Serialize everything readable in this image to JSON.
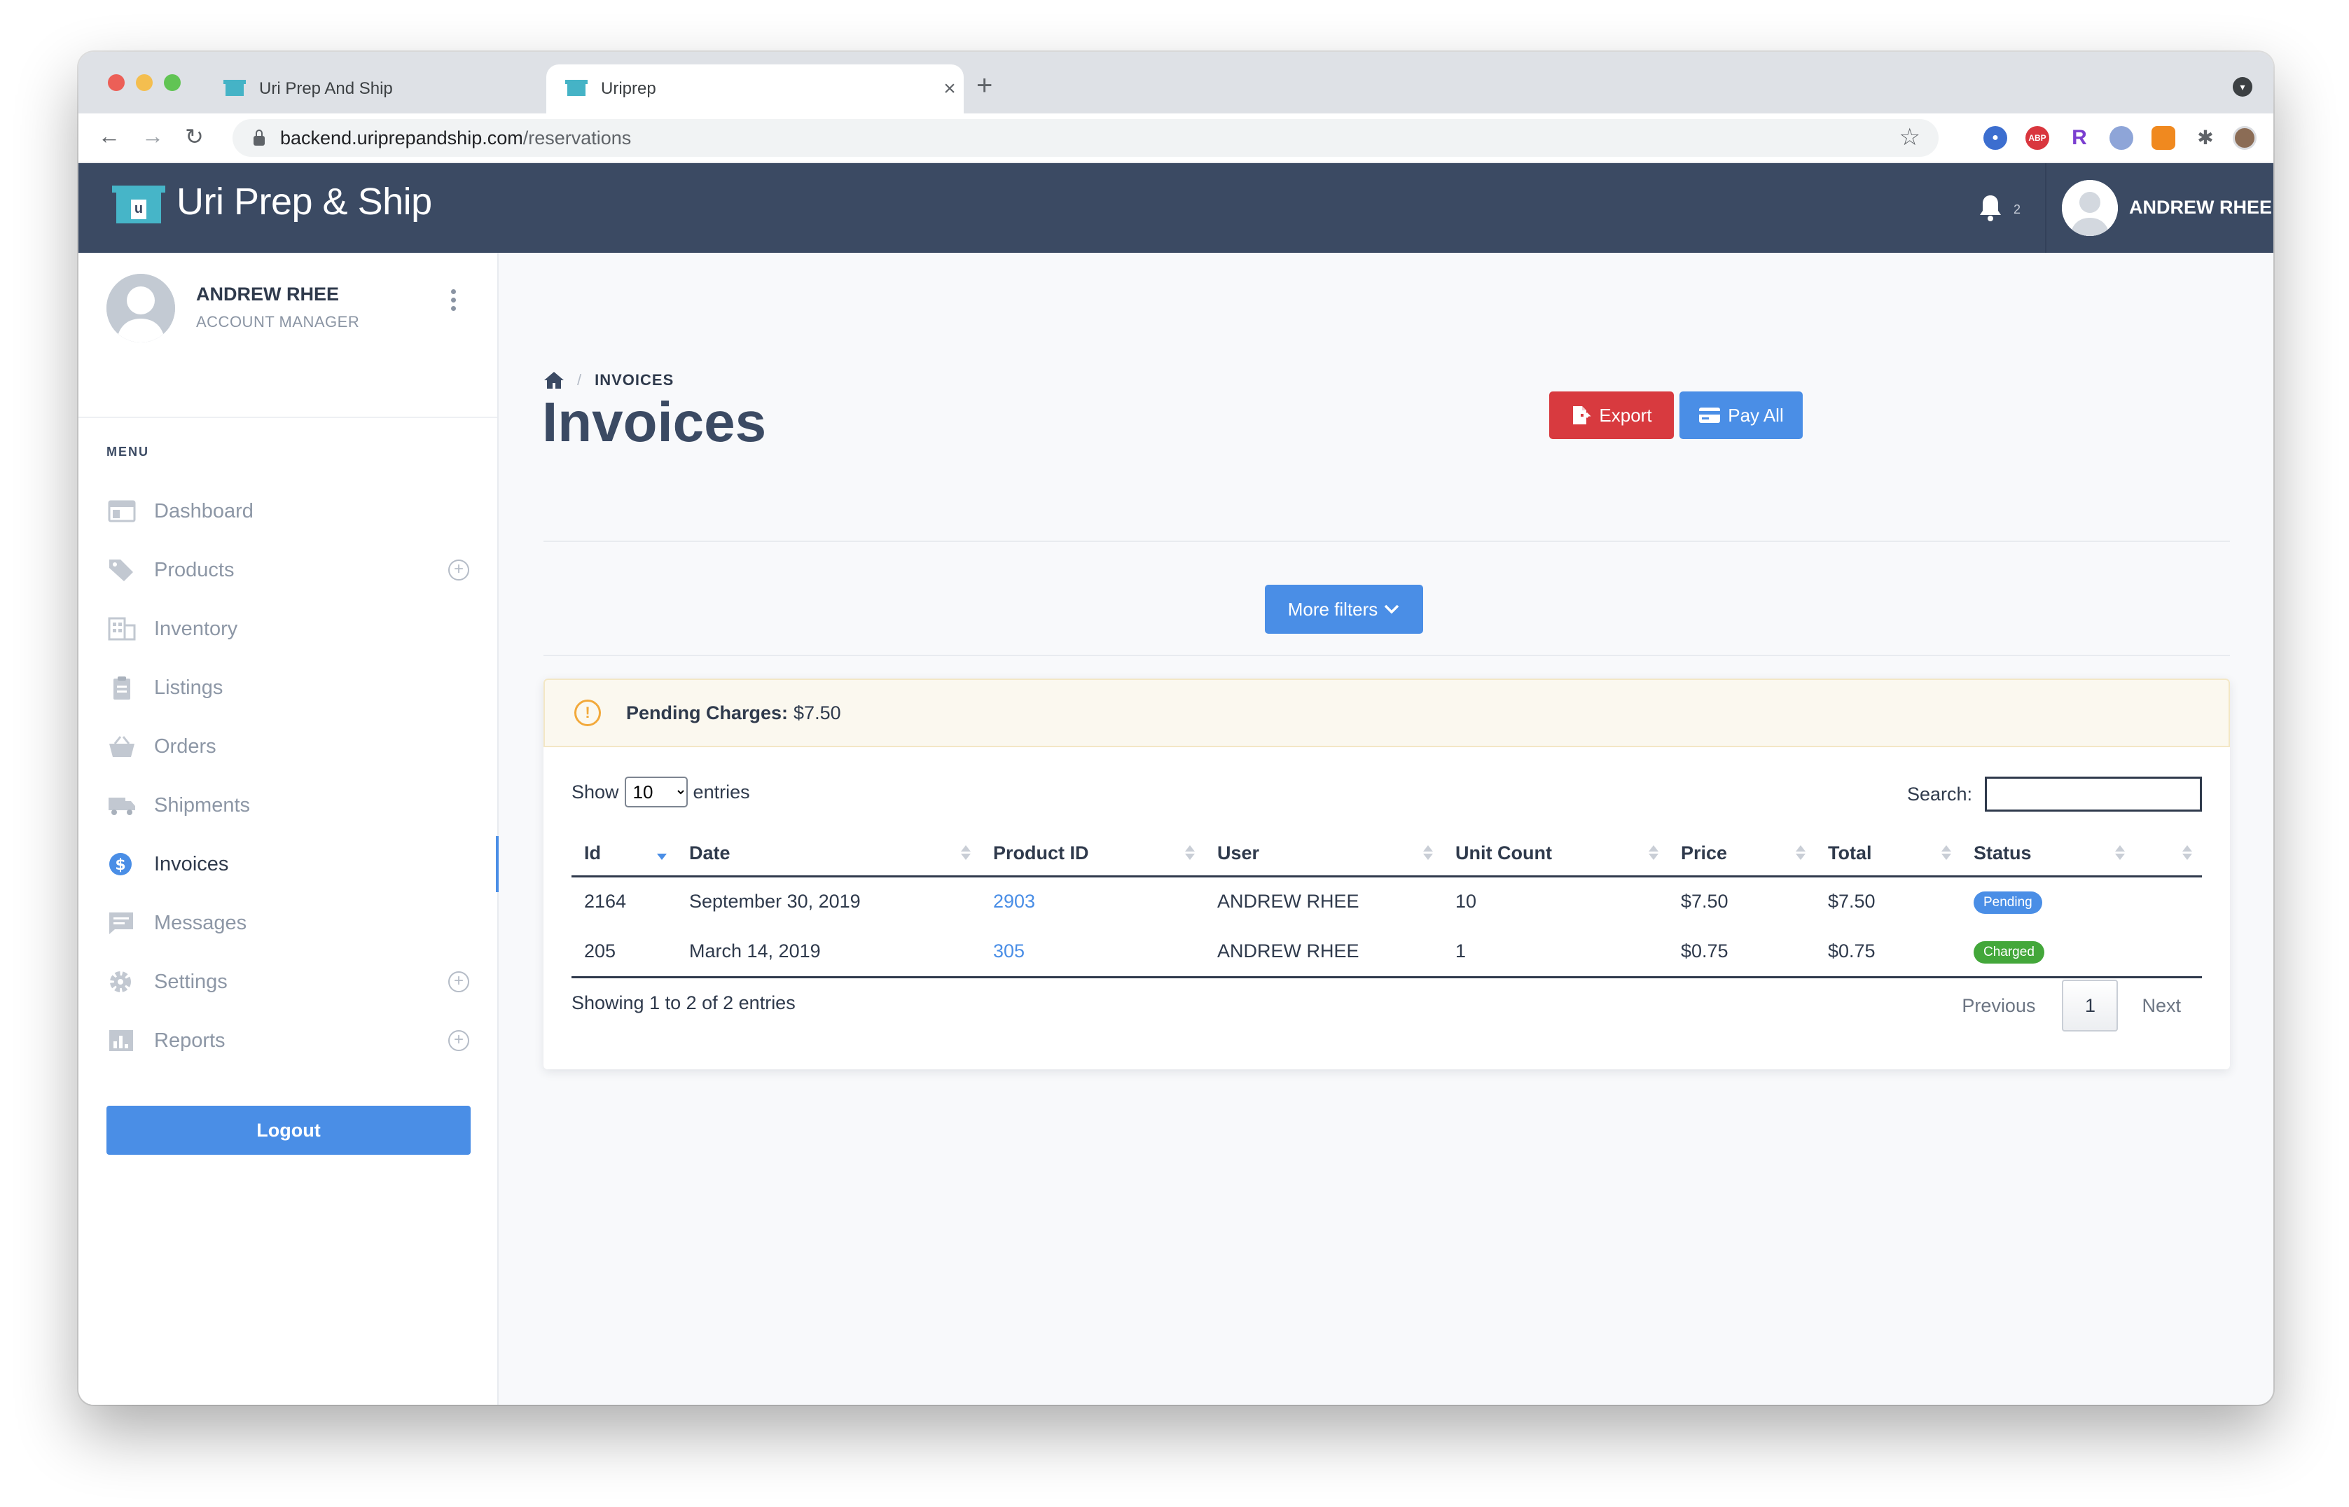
{
  "browser": {
    "tabs": [
      {
        "title": "Uri Prep And Ship",
        "active": false
      },
      {
        "title": "Uriprep",
        "active": true
      }
    ],
    "url_host": "backend.uriprepandship.com",
    "url_path": "/reservations",
    "extensions": [
      "ABP",
      "R"
    ]
  },
  "header": {
    "brand": "Uri Prep & Ship",
    "notification_count": "2",
    "user_name": "ANDREW RHEE"
  },
  "sidebar": {
    "profile_name": "ANDREW RHEE",
    "profile_role": "ACCOUNT MANAGER",
    "menu_label": "MENU",
    "items": [
      {
        "label": "Dashboard",
        "icon": "dashboard-icon"
      },
      {
        "label": "Products",
        "icon": "tag-icon",
        "expandable": true
      },
      {
        "label": "Inventory",
        "icon": "building-icon"
      },
      {
        "label": "Listings",
        "icon": "clipboard-icon"
      },
      {
        "label": "Orders",
        "icon": "basket-icon"
      },
      {
        "label": "Shipments",
        "icon": "truck-icon"
      },
      {
        "label": "Invoices",
        "icon": "dollar-icon",
        "active": true
      },
      {
        "label": "Messages",
        "icon": "message-icon"
      },
      {
        "label": "Settings",
        "icon": "gear-icon",
        "expandable": true
      },
      {
        "label": "Reports",
        "icon": "chart-icon",
        "expandable": true
      }
    ],
    "logout_label": "Logout"
  },
  "page": {
    "breadcrumb": "INVOICES",
    "title": "Invoices",
    "export_label": "Export",
    "payall_label": "Pay All",
    "filters_label": "More filters"
  },
  "alert": {
    "label": "Pending Charges:",
    "value": "$7.50"
  },
  "table": {
    "show_label": "Show",
    "page_size": "10",
    "entries_label": "entries",
    "search_label": "Search:",
    "columns": [
      "Id",
      "Date",
      "Product ID",
      "User",
      "Unit Count",
      "Price",
      "Total",
      "Status",
      ""
    ],
    "rows": [
      {
        "id": "2164",
        "date": "September 30, 2019",
        "product_id": "2903",
        "user": "ANDREW RHEE",
        "unit_count": "10",
        "price": "$7.50",
        "total": "$7.50",
        "status": "Pending"
      },
      {
        "id": "205",
        "date": "March 14, 2019",
        "product_id": "305",
        "user": "ANDREW RHEE",
        "unit_count": "1",
        "price": "$0.75",
        "total": "$0.75",
        "status": "Charged"
      }
    ],
    "info": "Showing 1 to 2 of 2 entries",
    "prev_label": "Previous",
    "current_page": "1",
    "next_label": "Next"
  },
  "colors": {
    "header_bg": "#3b4a63",
    "primary": "#4a8ee6",
    "danger": "#d83a3f",
    "success": "#43a73a",
    "warning": "#f2a93b"
  }
}
